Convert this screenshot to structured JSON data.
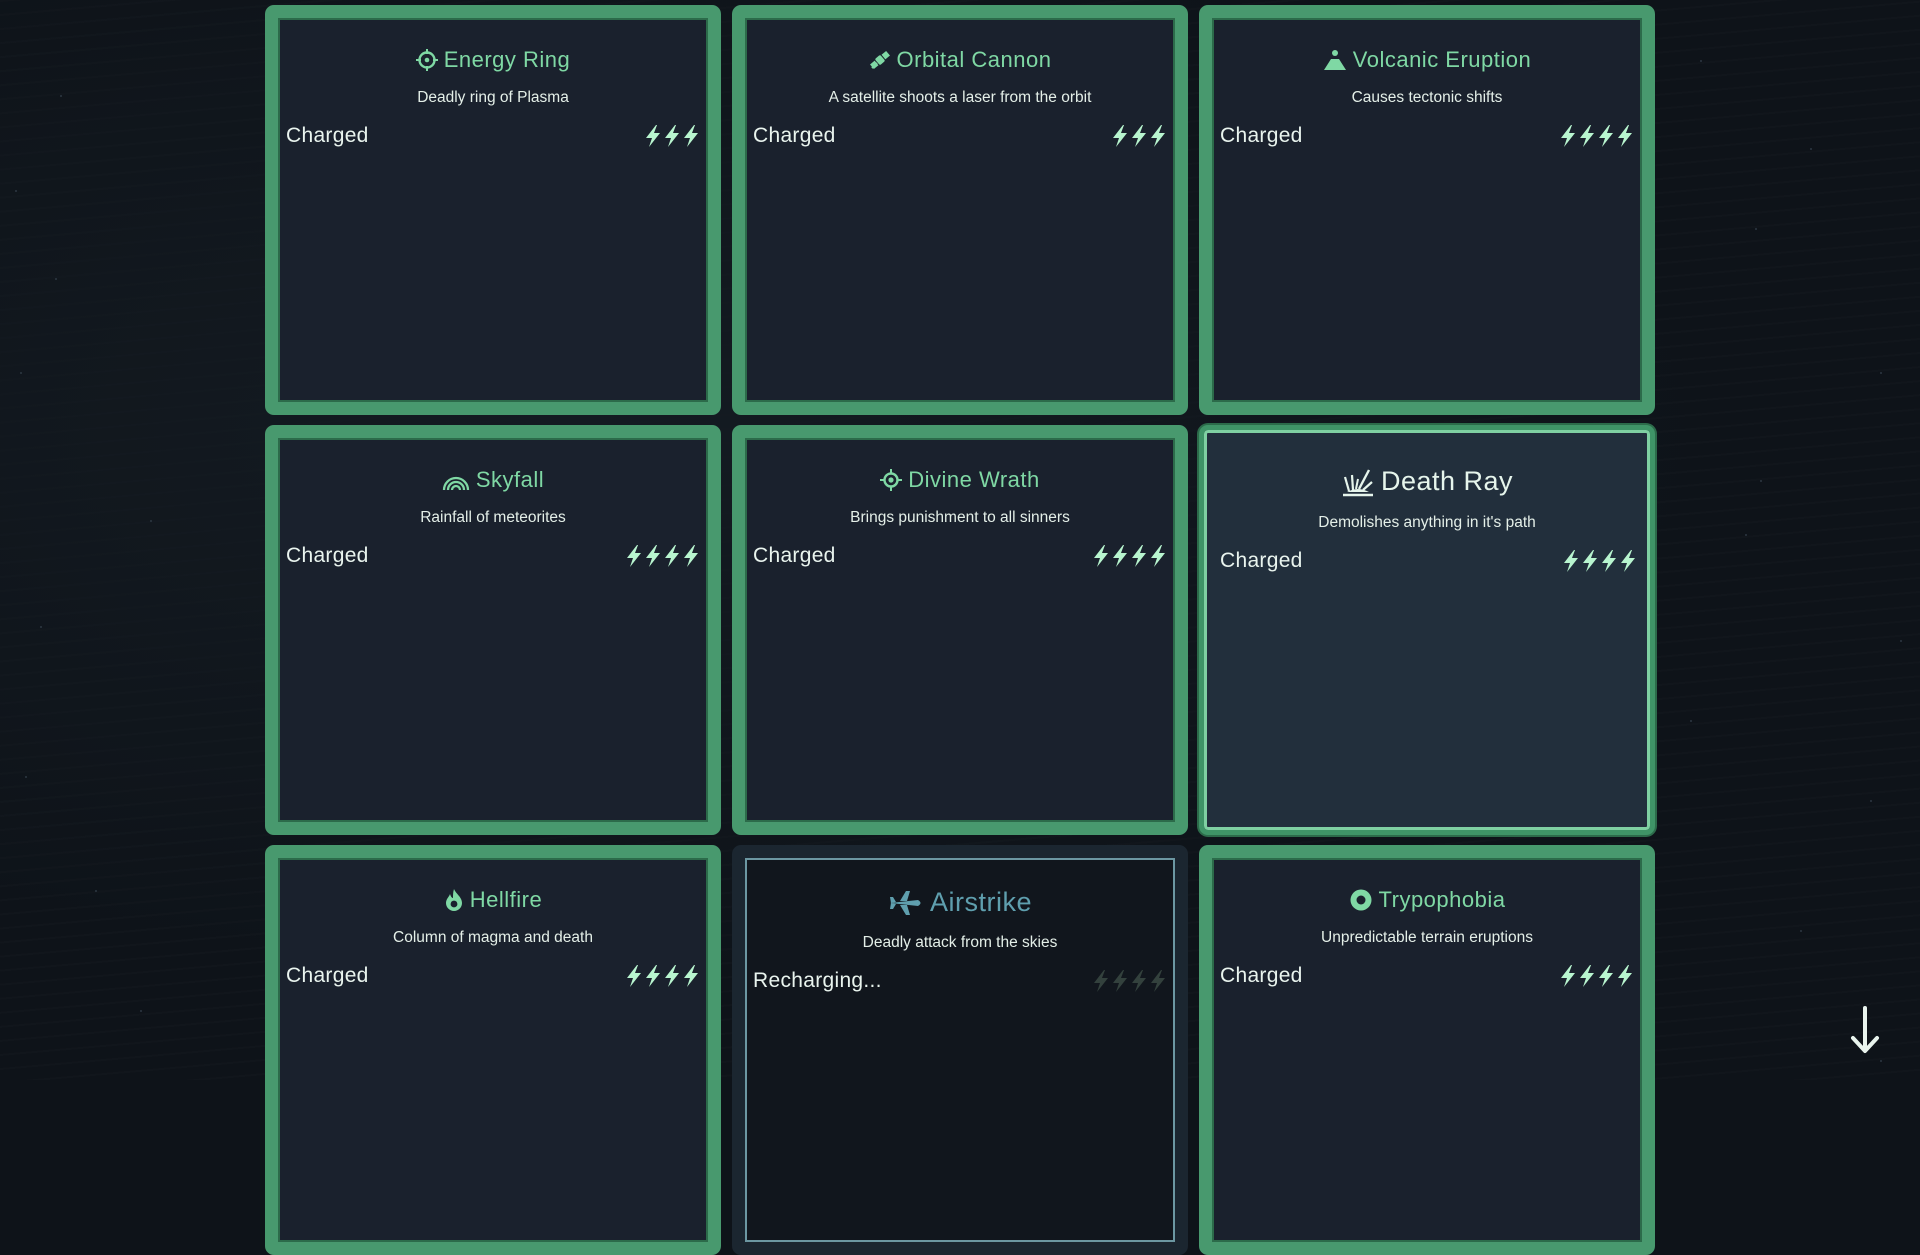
{
  "colors": {
    "accent": "#48996e",
    "title": "#7fd8a4",
    "bolt_on": "#b8f5cf",
    "bolt_off": "#33413d",
    "card_bg": "#1a212d"
  },
  "cards": [
    {
      "title": "Energy Ring",
      "icon": "crosshair-icon",
      "description": "Deadly ring of Plasma",
      "status": "Charged",
      "charges_filled": 3,
      "charges_total": 3,
      "state": "normal"
    },
    {
      "title": "Orbital Cannon",
      "icon": "satellite-icon",
      "description": "A satellite shoots a laser from the orbit",
      "status": "Charged",
      "charges_filled": 3,
      "charges_total": 3,
      "state": "normal"
    },
    {
      "title": "Volcanic Eruption",
      "icon": "volcano-icon",
      "description": "Causes tectonic shifts",
      "status": "Charged",
      "charges_filled": 4,
      "charges_total": 4,
      "state": "normal"
    },
    {
      "title": "Skyfall",
      "icon": "rainbow-icon",
      "description": "Rainfall of meteorites",
      "status": "Charged",
      "charges_filled": 4,
      "charges_total": 4,
      "state": "normal"
    },
    {
      "title": "Divine Wrath",
      "icon": "target-icon",
      "description": "Brings punishment to all sinners",
      "status": "Charged",
      "charges_filled": 4,
      "charges_total": 4,
      "state": "normal"
    },
    {
      "title": "Death Ray",
      "icon": "impact-icon",
      "description": "Demolishes anything in it's path",
      "status": "Charged",
      "charges_filled": 4,
      "charges_total": 4,
      "state": "selected"
    },
    {
      "title": "Hellfire",
      "icon": "fire-icon",
      "description": "Column of magma and death",
      "status": "Charged",
      "charges_filled": 4,
      "charges_total": 4,
      "state": "normal"
    },
    {
      "title": "Airstrike",
      "icon": "airplane-icon",
      "description": "Deadly attack from the skies",
      "status": "Recharging...",
      "charges_filled": 0,
      "charges_total": 4,
      "state": "disabled"
    },
    {
      "title": "Trypophobia",
      "icon": "circle-dot-icon",
      "description": "Unpredictable terrain eruptions",
      "status": "Charged",
      "charges_filled": 4,
      "charges_total": 4,
      "state": "normal"
    }
  ],
  "scroll_indicator": {
    "icon": "arrow-down-icon"
  }
}
